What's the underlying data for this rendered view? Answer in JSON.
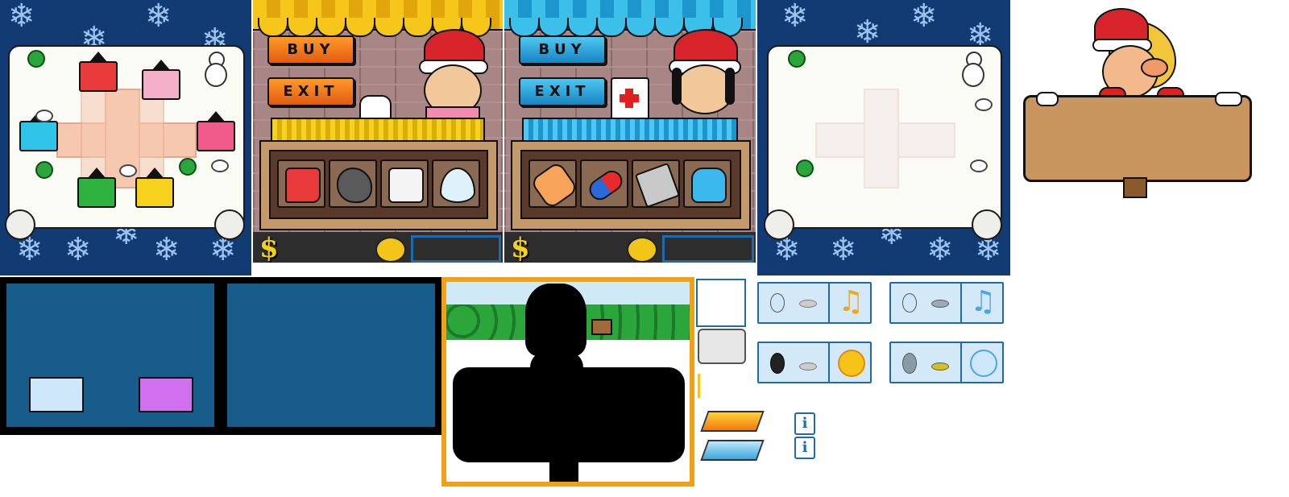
{
  "shop_left": {
    "buy_label": "BUY",
    "exit_label": "EXIT",
    "currency_symbol": "$",
    "theme_color": "#f7a21a",
    "items": [
      "boot-icon",
      "rock-icon",
      "ice-cube-icon",
      "water-drop-icon"
    ]
  },
  "shop_right": {
    "buy_label": "BUY",
    "exit_label": "EXIT",
    "currency_symbol": "$",
    "theme_color": "#2aa6e0",
    "items": [
      "bandage-icon",
      "pill-capsule-icon",
      "plaster-icon",
      "potion-bottle-icon"
    ]
  },
  "settings": [
    {
      "name": "music",
      "icon": "music-note-icon"
    },
    {
      "name": "sound",
      "icon": "sun-icon"
    }
  ],
  "info_label": "i",
  "colors": {
    "snow_bg": "#123a73",
    "panel": "#175c8a",
    "tile_light_blue": "#cfe7fa",
    "tile_purple": "#d070ee",
    "accent_orange": "#f7a21a",
    "accent_blue": "#2aa6e0"
  }
}
